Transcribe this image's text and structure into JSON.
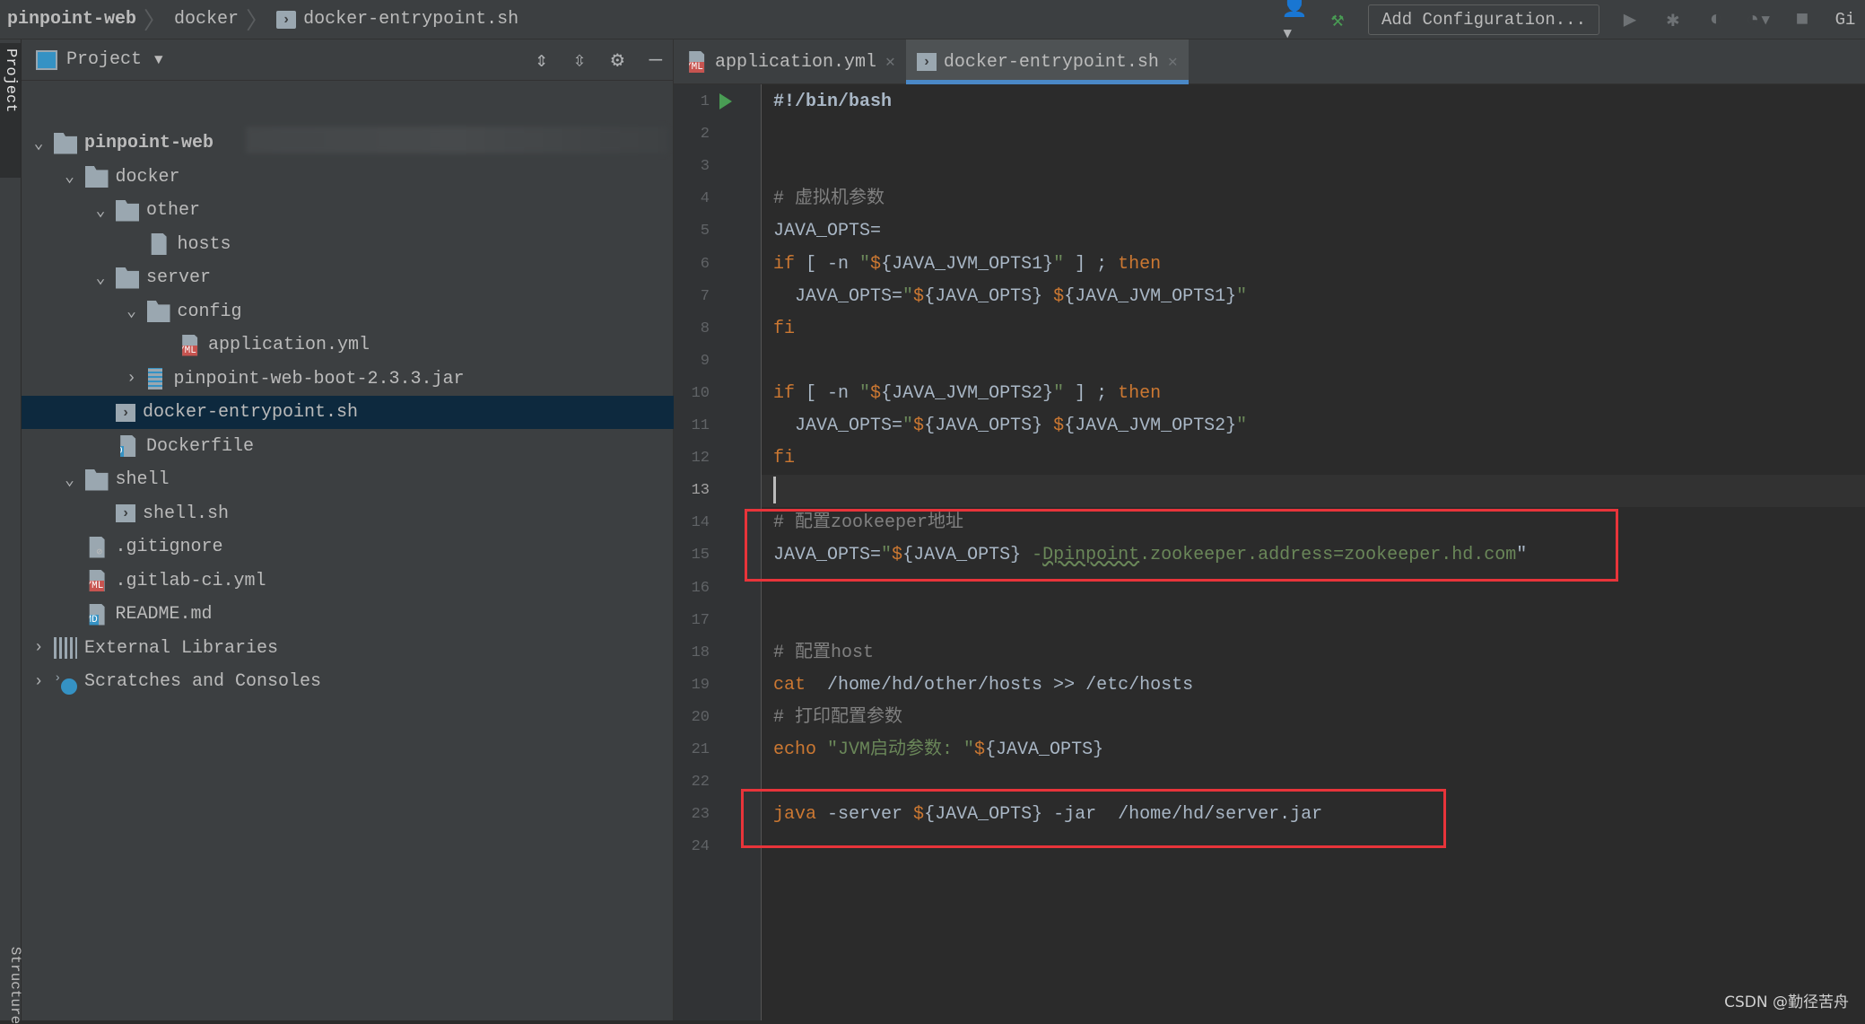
{
  "nav": {
    "breadcrumbs": [
      "pinpoint-web",
      "docker",
      "docker-entrypoint.sh"
    ],
    "add_configuration": "Add Configuration...",
    "right_clip": "Gi"
  },
  "stripe": {
    "project_label": "Project",
    "structure_label": "Structure"
  },
  "project": {
    "title": "Project",
    "tree": [
      {
        "depth": 0,
        "chev": "open",
        "icon": "module",
        "label": "pinpoint-web",
        "bold": true
      },
      {
        "depth": 1,
        "chev": "open",
        "icon": "folder",
        "label": "docker"
      },
      {
        "depth": 2,
        "chev": "open",
        "icon": "folder",
        "label": "other"
      },
      {
        "depth": 3,
        "chev": "none",
        "icon": "text",
        "label": "hosts"
      },
      {
        "depth": 2,
        "chev": "open",
        "icon": "folder",
        "label": "server"
      },
      {
        "depth": 3,
        "chev": "open",
        "icon": "folder",
        "label": "config"
      },
      {
        "depth": 4,
        "chev": "none",
        "icon": "yml",
        "label": "application.yml"
      },
      {
        "depth": 3,
        "chev": "closed",
        "icon": "jar",
        "label": "pinpoint-web-boot-2.3.3.jar"
      },
      {
        "depth": 2,
        "chev": "none",
        "icon": "shell",
        "label": "docker-entrypoint.sh",
        "selected": true
      },
      {
        "depth": 2,
        "chev": "none",
        "icon": "docker",
        "label": "Dockerfile"
      },
      {
        "depth": 1,
        "chev": "open",
        "icon": "folder",
        "label": "shell"
      },
      {
        "depth": 2,
        "chev": "none",
        "icon": "shell",
        "label": "shell.sh"
      },
      {
        "depth": 1,
        "chev": "none",
        "icon": "gitignore",
        "label": ".gitignore"
      },
      {
        "depth": 1,
        "chev": "none",
        "icon": "yml",
        "label": ".gitlab-ci.yml"
      },
      {
        "depth": 1,
        "chev": "none",
        "icon": "md",
        "label": "README.md"
      },
      {
        "depth": 0,
        "chev": "closed",
        "icon": "libraries",
        "label": "External Libraries"
      },
      {
        "depth": 0,
        "chev": "closed",
        "icon": "scratches",
        "label": "Scratches and Consoles"
      }
    ]
  },
  "tabs": [
    {
      "label": "application.yml",
      "icon": "yml",
      "active": false
    },
    {
      "label": "docker-entrypoint.sh",
      "icon": "shell",
      "active": true
    }
  ],
  "editor": {
    "current_line": 13,
    "lines": [
      [
        [
          "b",
          "#!/bin/bash"
        ]
      ],
      [],
      [],
      [
        [
          "c",
          "# 虚拟机参数"
        ]
      ],
      [
        [
          "d",
          "JAVA_OPTS="
        ]
      ],
      [
        [
          "k",
          "if"
        ],
        [
          "d",
          " [ -n "
        ],
        [
          "s",
          "\""
        ],
        [
          "v",
          "$"
        ],
        [
          "d",
          "{JAVA_JVM_OPTS1}"
        ],
        [
          "s",
          "\""
        ],
        [
          "d",
          " ] ; "
        ],
        [
          "k",
          "then"
        ]
      ],
      [
        [
          "d",
          "  JAVA_OPTS="
        ],
        [
          "s",
          "\""
        ],
        [
          "v",
          "$"
        ],
        [
          "d",
          "{JAVA_OPTS} "
        ],
        [
          "v",
          "$"
        ],
        [
          "d",
          "{JAVA_JVM_OPTS1}"
        ],
        [
          "s",
          "\""
        ]
      ],
      [
        [
          "k",
          "fi"
        ]
      ],
      [],
      [
        [
          "k",
          "if"
        ],
        [
          "d",
          " [ -n "
        ],
        [
          "s",
          "\""
        ],
        [
          "v",
          "$"
        ],
        [
          "d",
          "{JAVA_JVM_OPTS2}"
        ],
        [
          "s",
          "\""
        ],
        [
          "d",
          " ] ; "
        ],
        [
          "k",
          "then"
        ]
      ],
      [
        [
          "d",
          "  JAVA_OPTS="
        ],
        [
          "s",
          "\""
        ],
        [
          "v",
          "$"
        ],
        [
          "d",
          "{JAVA_OPTS} "
        ],
        [
          "v",
          "$"
        ],
        [
          "d",
          "{JAVA_JVM_OPTS2}"
        ],
        [
          "s",
          "\""
        ]
      ],
      [
        [
          "k",
          "fi"
        ]
      ],
      [
        [
          "caret",
          ""
        ]
      ],
      [
        [
          "c",
          "# 配置zookeeper地址"
        ]
      ],
      [
        [
          "d",
          "JAVA_OPTS="
        ],
        [
          "s",
          "\""
        ],
        [
          "v",
          "$"
        ],
        [
          "d",
          "{JAVA_OPTS} "
        ],
        [
          "s",
          "-"
        ],
        [
          "u",
          "Dpinpoint"
        ],
        [
          "s",
          ".zookeeper.address=zookeeper.hd.com"
        ],
        [
          "d",
          "\""
        ]
      ],
      [],
      [],
      [
        [
          "c",
          "# 配置host"
        ]
      ],
      [
        [
          "k",
          "cat"
        ],
        [
          "d",
          "  /home/hd/other/hosts >> /etc/hosts"
        ]
      ],
      [
        [
          "c",
          "# 打印配置参数"
        ]
      ],
      [
        [
          "k",
          "echo"
        ],
        [
          "s",
          " \"JVM启动参数: \""
        ],
        [
          "v",
          "$"
        ],
        [
          "d",
          "{JAVA_OPTS}"
        ]
      ],
      [],
      [
        [
          "k",
          "java"
        ],
        [
          "d",
          " -server "
        ],
        [
          "v",
          "$"
        ],
        [
          "d",
          "{JAVA_OPTS} -jar  /home/hd/server.jar"
        ]
      ],
      []
    ]
  },
  "highlight_color": "#e8343a",
  "watermark": "CSDN @勤径苦舟"
}
